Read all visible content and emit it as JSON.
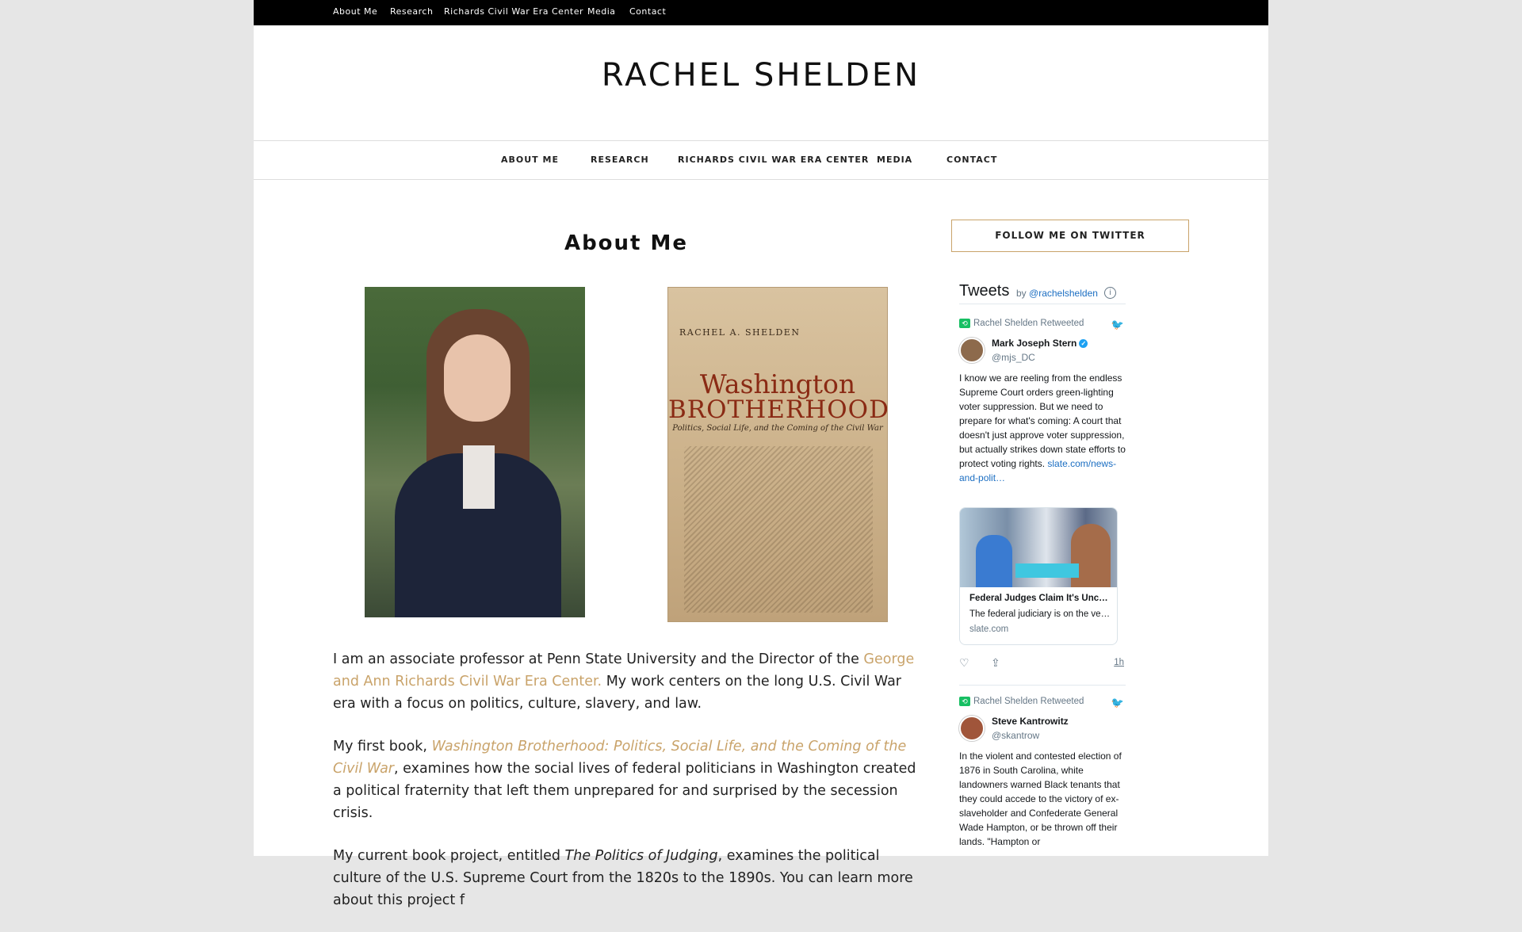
{
  "topnav": {
    "items": [
      "About Me",
      "Research",
      "Richards Civil War Era Center",
      "Media",
      "Contact"
    ]
  },
  "site": {
    "title": "RACHEL SHELDEN"
  },
  "mainnav": {
    "items": [
      "ABOUT ME",
      "RESEARCH",
      "RICHARDS CIVIL WAR ERA CENTER",
      "MEDIA",
      "CONTACT"
    ]
  },
  "main": {
    "title": "About Me",
    "book_cover": {
      "author": "RACHEL A. SHELDEN",
      "title_line1": "Washington",
      "title_line2": "BROTHERHOOD",
      "subtitle": "Politics, Social Life, and the Coming of the Civil War"
    },
    "p1_text1": "I am an associate professor at Penn State University and the Director of the ",
    "p1_link": "George and Ann Richards Civil War Era Center.",
    "p1_text2": " My work centers on the long U.S. Civil War era with a focus on politics, culture, slavery, and law.",
    "p2_text1": "My first book, ",
    "p2_link": "Washington Brotherhood: Politics, Social Life, and the Coming of the Civil War",
    "p2_text2": ", examines how the social lives of federal politicians in Washington created a political fraternity that left them unprepared for and surprised by the secession crisis.",
    "p3_text1": "My current book project, entitled ",
    "p3_italic": "The Politics of Judging",
    "p3_text2": ", examines the political culture of the U.S. Supreme Court from the 1820s to the 1890s. You can learn more about this project f"
  },
  "sidebar": {
    "follow_label": "FOLLOW ME ON TWITTER",
    "tweets": {
      "title": "Tweets",
      "by": "by ",
      "handle": "@rachelshelden",
      "info": "i",
      "items": [
        {
          "retweeted_by": "Rachel Shelden Retweeted",
          "author": "Mark Joseph Stern",
          "handle": "@mjs_DC",
          "text": "I know we are reeling from the endless Supreme Court orders green-lighting voter suppression. But we need to prepare for what's coming: A court that doesn't just approve voter suppression, but actually strikes down state efforts to protect voting rights. ",
          "link": "slate.com/news-and-polit…",
          "card_title": "Federal Judges Claim It's Unconstitutional to Protect Voters…",
          "card_desc": "The federal judiciary is on the verge of…",
          "card_source": "slate.com",
          "time": "1h"
        },
        {
          "retweeted_by": "Rachel Shelden Retweeted",
          "author": "Steve Kantrowitz",
          "handle": "@skantrow",
          "text": "In the violent and contested election of 1876 in South Carolina, white landowners warned Black tenants that they could accede to the victory of ex-slaveholder and Confederate General Wade Hampton, or be thrown off their lands. \"Hampton or"
        }
      ]
    }
  }
}
